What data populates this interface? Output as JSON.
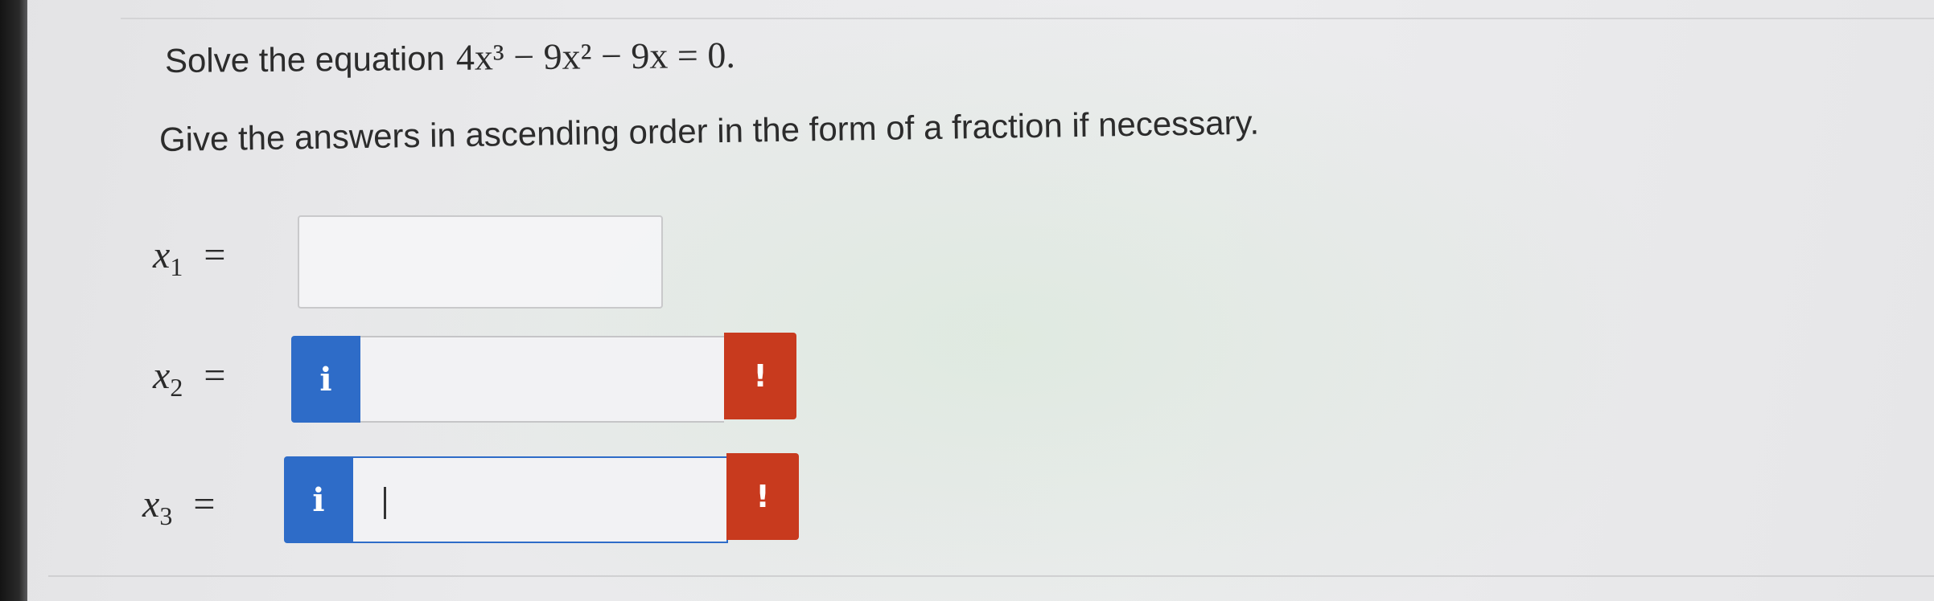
{
  "question": {
    "prefix": "Solve the equation",
    "equation": "4x³ − 9x² − 9x = 0."
  },
  "instructions": "Give the answers in ascending order in the form of a fraction if necessary.",
  "answers": [
    {
      "var": "x",
      "sub": "1",
      "eq": "=",
      "value": ""
    },
    {
      "var": "x",
      "sub": "2",
      "eq": "=",
      "value": "",
      "info": "i",
      "warn": "!"
    },
    {
      "var": "x",
      "sub": "3",
      "eq": "=",
      "value": "",
      "info": "i",
      "warn": "!"
    }
  ],
  "colors": {
    "info": "#2e6cc8",
    "warn": "#c83a1e"
  }
}
